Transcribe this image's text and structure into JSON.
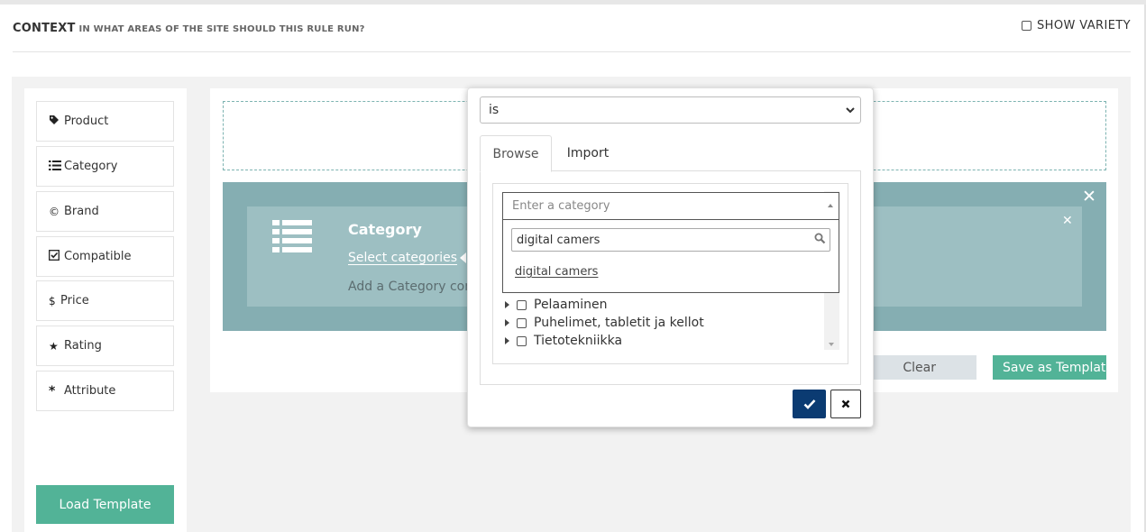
{
  "header": {
    "title": "CONTEXT",
    "subtitle": "IN WHAT AREAS OF THE SITE SHOULD THIS RULE RUN?",
    "show_variety_label": "SHOW VARIETY"
  },
  "sidebar": {
    "items": [
      {
        "label": "Product",
        "icon": "tag-icon"
      },
      {
        "label": "Category",
        "icon": "list-icon"
      },
      {
        "label": "Brand",
        "icon": "copyright-icon"
      },
      {
        "label": "Compatible",
        "icon": "check-square-icon"
      },
      {
        "label": "Price",
        "icon": "dollar-icon"
      },
      {
        "label": "Rating",
        "icon": "star-icon"
      },
      {
        "label": "Attribute",
        "icon": "asterisk-icon"
      }
    ],
    "load_template_label": "Load Template"
  },
  "rule": {
    "title": "Category",
    "link": "Select categories",
    "description": "Add a Category condition"
  },
  "actions": {
    "clear_label": "Clear",
    "save_template_label": "Save as Template"
  },
  "popup": {
    "operator_value": "is",
    "tabs": [
      {
        "label": "Browse",
        "active": true
      },
      {
        "label": "Import",
        "active": false
      }
    ],
    "category_placeholder": "Enter a category",
    "search_value": "digital camers",
    "search_result": "digital camers",
    "tree_items": [
      {
        "label": "Pelaaminen"
      },
      {
        "label": "Puhelimet, tabletit ja kellot"
      },
      {
        "label": "Tietotekniikka"
      }
    ]
  },
  "colors": {
    "accent_green": "#52b397",
    "rule_block": "#85aeb2",
    "rule_card": "#9dbfc2",
    "confirm_navy": "#0b3b72",
    "clear_gray": "#dce2e6"
  }
}
